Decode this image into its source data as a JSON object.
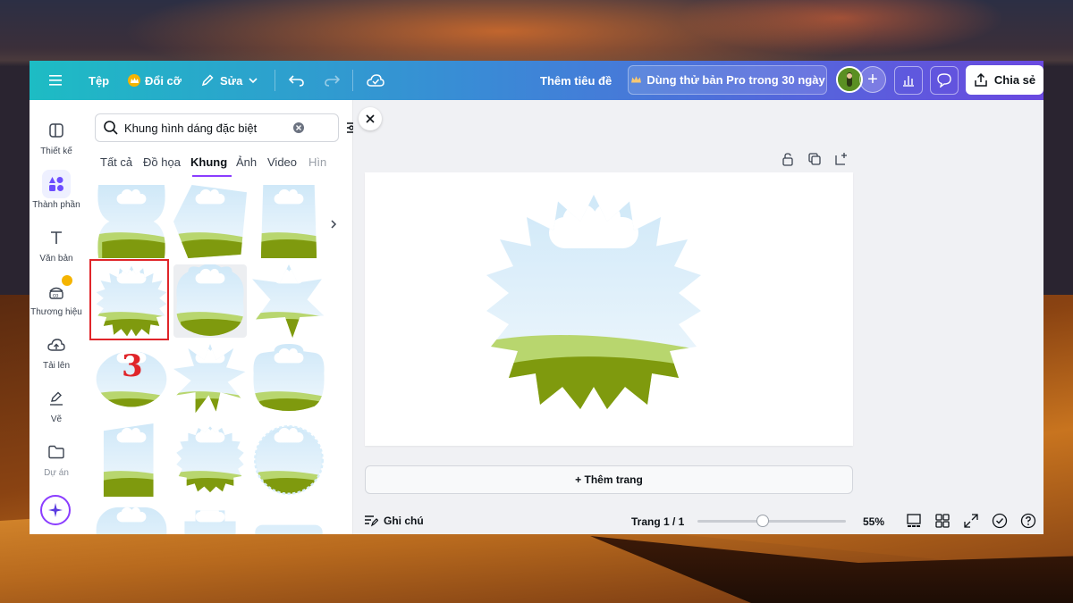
{
  "topbar": {
    "file": "Tệp",
    "resize": "Đổi cỡ",
    "edit": "Sửa",
    "design_title": "Thêm tiêu đề",
    "pro_trial": "Dùng thử bản Pro trong 30 ngày",
    "share": "Chia sẻ"
  },
  "rail": {
    "items": [
      {
        "label": "Thiết kế",
        "icon": "layout-icon"
      },
      {
        "label": "Thành phần",
        "icon": "shapes-icon"
      },
      {
        "label": "Văn bản",
        "icon": "text-icon"
      },
      {
        "label": "Thương hiệu",
        "icon": "brand-icon"
      },
      {
        "label": "Tải lên",
        "icon": "upload-cloud-icon"
      },
      {
        "label": "Vẽ",
        "icon": "draw-pen-icon"
      },
      {
        "label": "Dự án",
        "icon": "folder-icon"
      }
    ]
  },
  "panel": {
    "search_value": "Khung hình dáng đặc biệt",
    "tabs": [
      "Tất cả",
      "Đồ họa",
      "Khung",
      "Ảnh",
      "Video",
      "Hìn"
    ],
    "active_tab": "Khung",
    "step_marker": "3"
  },
  "footer": {
    "notes": "Ghi chú",
    "page_indicator": "Trang 1 / 1",
    "zoom": "55%",
    "zoom_fraction": 0.55
  },
  "canvas": {
    "add_page": "+ Thêm trang"
  },
  "colors": {
    "accent": "#8b3dff",
    "highlight": "#e0252a",
    "sky": "#d8eefb",
    "grass_light": "#b8d66e",
    "grass_dark": "#7f9a0e"
  }
}
